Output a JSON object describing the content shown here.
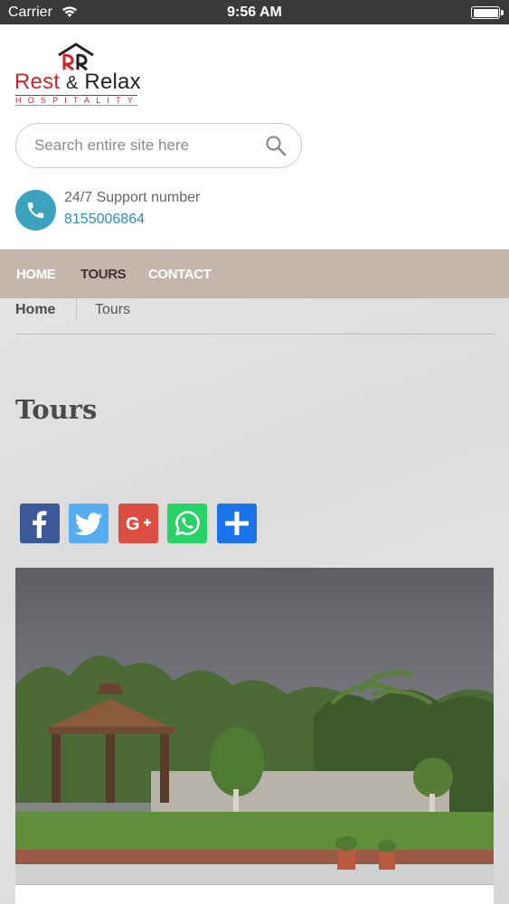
{
  "status_bar": {
    "carrier": "Carrier",
    "time": "9:56 AM"
  },
  "logo": {
    "brand_part1": "Rest ",
    "brand_amp": "&",
    "brand_part2": " Relax",
    "tagline": "HOSPITALITY"
  },
  "search": {
    "placeholder": "Search entire site here"
  },
  "support": {
    "label": "24/7 Support number",
    "number": "8155006864"
  },
  "nav": {
    "items": [
      {
        "label": "HOME"
      },
      {
        "label": "TOURS"
      },
      {
        "label": "CONTACT"
      }
    ]
  },
  "breadcrumb": {
    "home": "Home",
    "current": "Tours"
  },
  "page": {
    "title": "Tours"
  },
  "share": {
    "buttons": [
      {
        "icon": "facebook-icon",
        "color": "#3b5998"
      },
      {
        "icon": "twitter-icon",
        "color": "#55acee"
      },
      {
        "icon": "google-plus-icon",
        "color": "#dc4e41"
      },
      {
        "icon": "whatsapp-icon",
        "color": "#25d366"
      },
      {
        "icon": "share-plus-icon",
        "color": "#1a73e8"
      }
    ]
  },
  "colors": {
    "nav_bg": "#c5b6ad",
    "accent": "#3ba3bd",
    "brand_red": "#d2232a"
  }
}
